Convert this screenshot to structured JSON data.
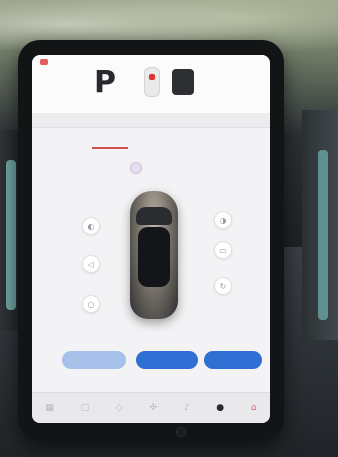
{
  "status_bar": {
    "gear": "P"
  },
  "dock": {
    "icons": [
      "grid-icon",
      "window-icon",
      "car-icon",
      "fan-icon",
      "music-icon",
      "user-icon",
      "home-icon"
    ]
  },
  "colors": {
    "accent_blue": "#2f6fd3",
    "light_blue": "#a7c1ea",
    "accent_red": "#d05050",
    "screen_bg": "#f3f3f5"
  }
}
